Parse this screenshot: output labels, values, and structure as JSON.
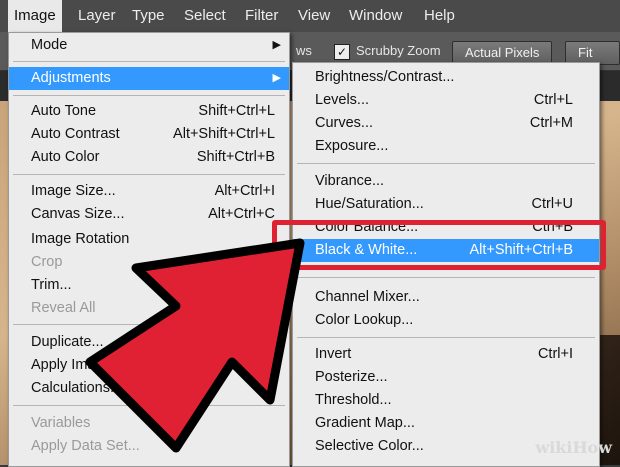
{
  "menubar": {
    "items": [
      "Image",
      "Layer",
      "Type",
      "Select",
      "Filter",
      "View",
      "Window",
      "Help"
    ],
    "active": "Image"
  },
  "options_bar": {
    "windows_fragment": "ws",
    "scrubby_zoom": "Scrubby Zoom",
    "scrubby_checked": "✓",
    "actual_pixels": "Actual Pixels",
    "fit_screen": "Fit Scre"
  },
  "image_menu": {
    "items": [
      {
        "label": "Mode",
        "shortcut": "",
        "submenu": true
      },
      {
        "label": "Adjustments",
        "shortcut": "",
        "submenu": true
      },
      {
        "label": "Auto Tone",
        "shortcut": "Shift+Ctrl+L"
      },
      {
        "label": "Auto Contrast",
        "shortcut": "Alt+Shift+Ctrl+L"
      },
      {
        "label": "Auto Color",
        "shortcut": "Shift+Ctrl+B"
      },
      {
        "label": "Image Size...",
        "shortcut": "Alt+Ctrl+I"
      },
      {
        "label": "Canvas Size...",
        "shortcut": "Alt+Ctrl+C"
      },
      {
        "label": "Image Rotation",
        "shortcut": ""
      },
      {
        "label": "Crop",
        "shortcut": ""
      },
      {
        "label": "Trim...",
        "shortcut": ""
      },
      {
        "label": "Reveal All",
        "shortcut": ""
      },
      {
        "label": "Duplicate...",
        "shortcut": ""
      },
      {
        "label": "Apply Image...",
        "shortcut": ""
      },
      {
        "label": "Calculations...",
        "shortcut": ""
      },
      {
        "label": "Variables",
        "shortcut": ""
      },
      {
        "label": "Apply Data Set...",
        "shortcut": ""
      }
    ],
    "submenu_arrow": "▶"
  },
  "adjust_menu": {
    "items": [
      {
        "label": "Brightness/Contrast...",
        "shortcut": ""
      },
      {
        "label": "Levels...",
        "shortcut": "Ctrl+L"
      },
      {
        "label": "Curves...",
        "shortcut": "Ctrl+M"
      },
      {
        "label": "Exposure...",
        "shortcut": ""
      },
      {
        "label": "Vibrance...",
        "shortcut": ""
      },
      {
        "label": "Hue/Saturation...",
        "shortcut": "Ctrl+U"
      },
      {
        "label": "Color Balance...",
        "shortcut": "Ctrl+B"
      },
      {
        "label": "Black & White...",
        "shortcut": "Alt+Shift+Ctrl+B"
      },
      {
        "label": "Channel Mixer...",
        "shortcut": ""
      },
      {
        "label": "Color Lookup...",
        "shortcut": ""
      },
      {
        "label": "Invert",
        "shortcut": "Ctrl+I"
      },
      {
        "label": "Posterize...",
        "shortcut": ""
      },
      {
        "label": "Threshold...",
        "shortcut": ""
      },
      {
        "label": "Gradient Map...",
        "shortcut": ""
      },
      {
        "label": "Selective Color...",
        "shortcut": ""
      }
    ]
  },
  "watermark": "wikiHow",
  "colors": {
    "highlight": "#3399ff",
    "callout_red": "#e02133"
  }
}
